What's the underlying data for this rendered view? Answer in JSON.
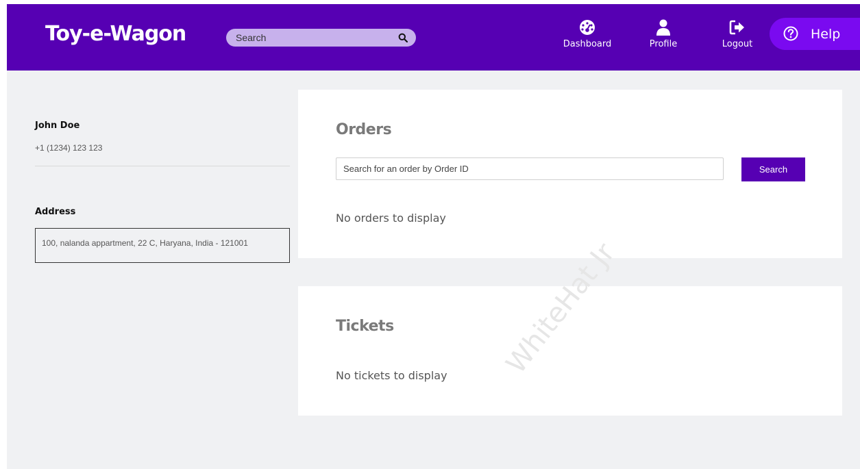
{
  "header": {
    "brand": "Toy-e-Wagon",
    "search_placeholder": "Search",
    "nav": [
      {
        "label": "Dashboard",
        "icon": "dashboard-gauge-icon"
      },
      {
        "label": "Profile",
        "icon": "user-icon"
      },
      {
        "label": "Logout",
        "icon": "logout-icon"
      }
    ],
    "help_label": "Help"
  },
  "profile": {
    "name": "John Doe",
    "phone": "+1 (1234) 123 123",
    "address_title": "Address",
    "address": "100, nalanda appartment, 22 C, Haryana, India - 121001"
  },
  "orders": {
    "title": "Orders",
    "search_placeholder": "Search for an order by Order ID",
    "search_button": "Search",
    "empty": "No orders to display"
  },
  "tickets": {
    "title": "Tickets",
    "empty": "No tickets to display"
  },
  "watermark": "WhiteHat Jr",
  "colors": {
    "brand_purple": "#5600b3",
    "help_purple": "#7a0af0",
    "search_pill": "#c7b1ec",
    "background": "#f0f1f3"
  }
}
